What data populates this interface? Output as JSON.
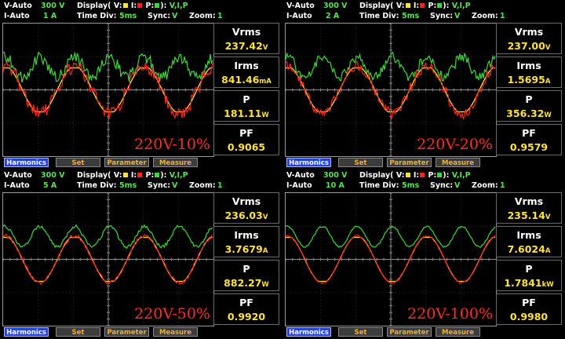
{
  "labels": {
    "v_auto": "V-Auto",
    "i_auto": "I-Auto",
    "display": "Display( V:",
    "i": "I:",
    "p": "P:",
    "close": "):",
    "time_div": "Time Div:",
    "sync": "Sync:",
    "zoom": "Zoom:",
    "vrms": "Vrms",
    "irms": "Irms",
    "p_label": "P",
    "pf": "PF",
    "harmonics": "Harmonics",
    "set": "Set",
    "parameter": "Parameter",
    "measure": "Measure"
  },
  "colors": {
    "voltage": "#ffe23a",
    "current": "#ff2020",
    "power": "#3cd83c"
  },
  "panels": [
    {
      "v_range": "300 V",
      "i_range": "1 A",
      "display_sel": "V,I,P",
      "time_div": "5ms",
      "sync": "V",
      "zoom": "1",
      "vrms": "237.42",
      "vrms_unit": "V",
      "irms": "841.46",
      "irms_unit": "mA",
      "p": "181.11",
      "p_unit": "W",
      "pf": "0.9065",
      "overlay": "220V-10%"
    },
    {
      "v_range": "300 V",
      "i_range": "2 A",
      "display_sel": "V,I,P",
      "time_div": "5ms",
      "sync": "V",
      "zoom": "1",
      "vrms": "237.00",
      "vrms_unit": "V",
      "irms": "1.5695",
      "irms_unit": "A",
      "p": "356.32",
      "p_unit": "W",
      "pf": "0.9579",
      "overlay": "220V-20%"
    },
    {
      "v_range": "300 V",
      "i_range": "5 A",
      "display_sel": "V,I,P",
      "time_div": "5ms",
      "sync": "V",
      "zoom": "1",
      "vrms": "236.03",
      "vrms_unit": "V",
      "irms": "3.7679",
      "irms_unit": "A",
      "p": "882.27",
      "p_unit": "W",
      "pf": "0.9920",
      "overlay": "220V-50%"
    },
    {
      "v_range": "300 V",
      "i_range": "10 A",
      "display_sel": "V,I,P",
      "time_div": "5ms",
      "sync": "V",
      "zoom": "1",
      "vrms": "235.14",
      "vrms_unit": "V",
      "irms": "7.6024",
      "irms_unit": "A",
      "p": "1.7841",
      "p_unit": "kW",
      "pf": "0.9980",
      "overlay": "220V-100%"
    }
  ]
}
